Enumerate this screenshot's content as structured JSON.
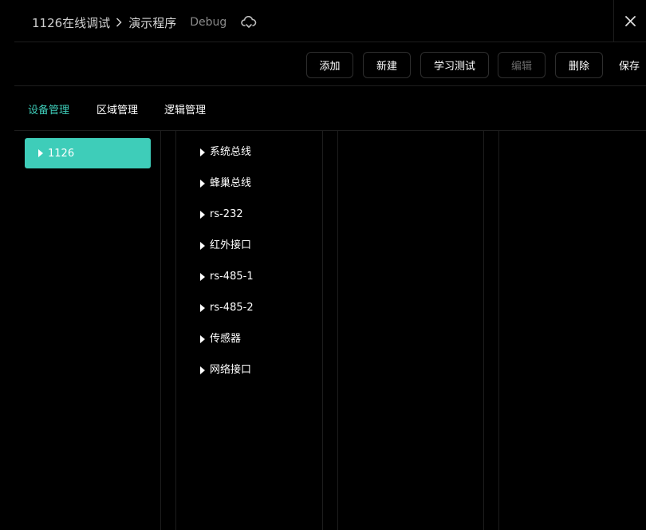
{
  "header": {
    "project": "1126在线调试",
    "program": "演示程序",
    "mode": "Debug",
    "icons": {
      "separator": "chevron-right-icon",
      "cloud": "cloud-sync-icon",
      "close": "close-icon"
    }
  },
  "toolbar": {
    "add": "添加",
    "new": "新建",
    "learn_test": "学习测试",
    "edit": "编辑",
    "delete": "删除",
    "save": "保存"
  },
  "tabs": [
    {
      "label": "设备管理",
      "active": true
    },
    {
      "label": "区域管理",
      "active": false
    },
    {
      "label": "逻辑管理",
      "active": false
    }
  ],
  "devices": [
    {
      "label": "1126",
      "selected": true
    }
  ],
  "interfaces": [
    "系统总线",
    "蜂巢总线",
    "rs-232",
    "红外接口",
    "rs-485-1",
    "rs-485-2",
    "传感器",
    "网络接口"
  ],
  "colors": {
    "accent": "#3ecdb9",
    "background": "#000000",
    "divider": "#1d1d1d",
    "disabled_text": "#6a6a6a"
  }
}
